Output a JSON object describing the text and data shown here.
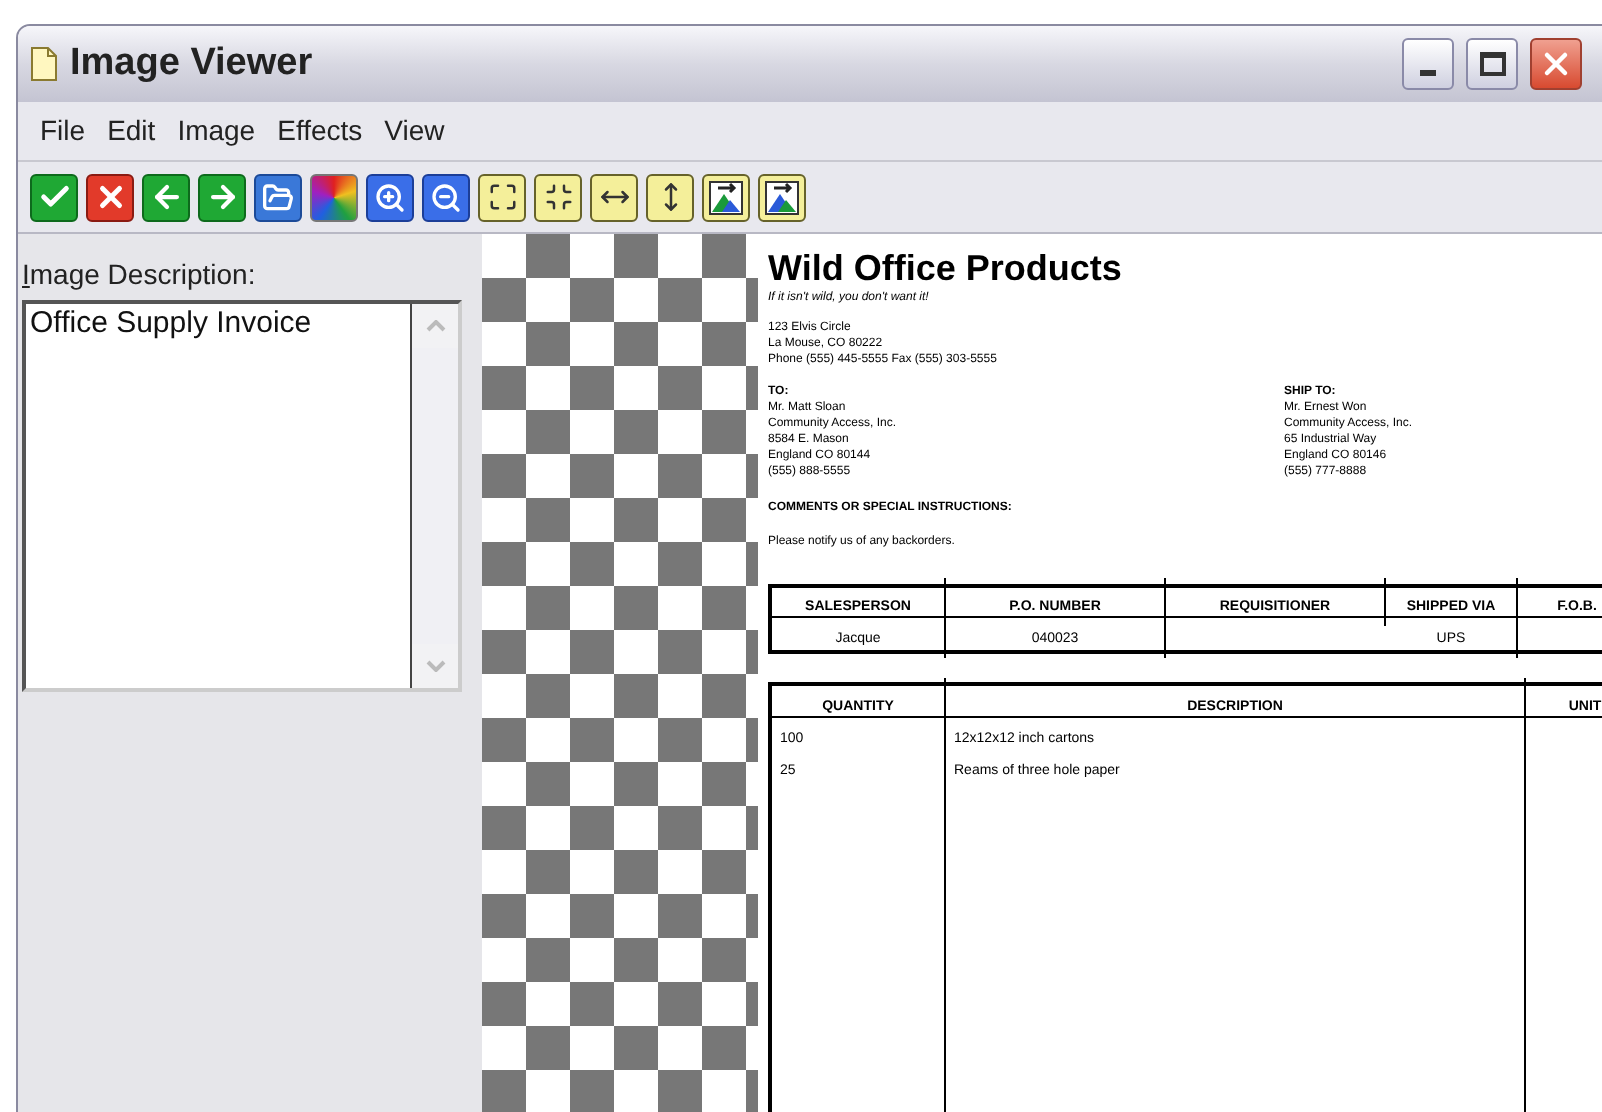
{
  "window": {
    "title": "Image Viewer"
  },
  "menu": [
    {
      "label": "File"
    },
    {
      "label": "Edit"
    },
    {
      "label": "Image"
    },
    {
      "label": "Effects"
    },
    {
      "label": "View"
    }
  ],
  "toolbar": [
    {
      "kind": "accept"
    },
    {
      "kind": "reject"
    },
    {
      "kind": "back"
    },
    {
      "kind": "forward"
    },
    {
      "kind": "open"
    },
    {
      "kind": "colors"
    },
    {
      "kind": "zoomin"
    },
    {
      "kind": "zoomout"
    },
    {
      "kind": "fit"
    },
    {
      "kind": "fullsize"
    },
    {
      "kind": "width"
    },
    {
      "kind": "height"
    },
    {
      "kind": "pictureup"
    },
    {
      "kind": "pictureright"
    }
  ],
  "description_panel": {
    "label": "Image Description:",
    "value": "Office Supply Invoice"
  },
  "document": {
    "company": "Wild Office Products",
    "tagline": "If it isn't wild, you don't want it!",
    "address": [
      "123 Elvis Circle",
      "La Mouse, CO 80222",
      "Phone (555) 445-5555  Fax (555) 303-5555"
    ],
    "to": {
      "heading": "TO:",
      "lines": [
        "Mr. Matt Sloan",
        "Community Access, Inc.",
        "8584 E. Mason",
        "England CO 80144",
        "(555) 888-5555"
      ]
    },
    "ship_to": {
      "heading": "SHIP TO:",
      "lines": [
        "Mr. Ernest Won",
        "Community Access, Inc.",
        "65 Industrial Way",
        "England CO 80146",
        "(555) 777-8888"
      ]
    },
    "comments_heading": "COMMENTS OR SPECIAL INSTRUCTIONS:",
    "comments": "Please notify us of any backorders.",
    "order_table": {
      "columns": [
        "SALESPERSON",
        "P.O. NUMBER",
        "REQUISITIONER",
        "SHIPPED VIA",
        "F.O.B."
      ],
      "rows": [
        [
          "Jacque",
          "040023",
          null,
          "UPS",
          null
        ]
      ]
    },
    "items_table": {
      "columns": [
        "QUANTITY",
        "DESCRIPTION",
        "UNIT"
      ],
      "rows": [
        [
          "100",
          "12x12x12 inch cartons",
          null
        ],
        [
          "25",
          "Reams of three hole paper",
          null
        ]
      ]
    }
  }
}
